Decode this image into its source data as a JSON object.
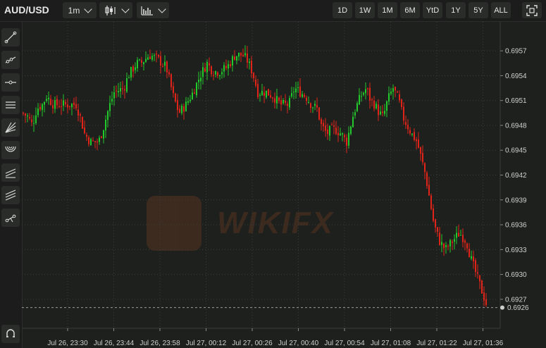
{
  "header": {
    "symbol": "AUD/USD",
    "interval": "1m",
    "ranges": [
      "1D",
      "1W",
      "1M",
      "6M",
      "YtD",
      "1Y",
      "5Y",
      "ALL"
    ]
  },
  "sidebar_tools": [
    "trend-line-icon",
    "ray-icon",
    "horizontal-line-icon",
    "parallel-channel-icon",
    "fib-fan-icon",
    "fib-arc-icon",
    "fib-retracement-icon",
    "fib-extension-icon",
    "pitchfork-icon",
    "magnet-icon"
  ],
  "watermark": "WIKIFX",
  "colors": {
    "up": "#22c92b",
    "down": "#e0241a",
    "background": "#1e201e"
  },
  "chart_data": {
    "type": "candlestick",
    "yticks": [
      0.6957,
      0.6954,
      0.6951,
      0.6948,
      0.6945,
      0.6942,
      0.6939,
      0.6936,
      0.6933,
      0.693,
      0.6927
    ],
    "ylim": [
      0.69235,
      0.69605
    ],
    "xtick_labels": [
      "Jul 26, 23:30",
      "Jul 26, 23:44",
      "Jul 26, 23:58",
      "Jul 27, 00:12",
      "Jul 27, 00:26",
      "Jul 27, 00:40",
      "Jul 27, 00:54",
      "Jul 27, 01:08",
      "Jul 27, 01:22",
      "Jul 27, 01:36"
    ],
    "last_price": 0.6926,
    "close_path": [
      [
        0,
        0.69495
      ],
      [
        8,
        0.6949
      ],
      [
        14,
        0.6948
      ],
      [
        20,
        0.695
      ],
      [
        28,
        0.69505
      ],
      [
        34,
        0.69515
      ],
      [
        44,
        0.69505
      ],
      [
        56,
        0.69505
      ],
      [
        68,
        0.69505
      ],
      [
        76,
        0.69505
      ],
      [
        82,
        0.6949
      ],
      [
        88,
        0.6947
      ],
      [
        96,
        0.6946
      ],
      [
        104,
        0.6946
      ],
      [
        108,
        0.6946
      ],
      [
        114,
        0.69475
      ],
      [
        122,
        0.695
      ],
      [
        130,
        0.6952
      ],
      [
        144,
        0.69525
      ],
      [
        150,
        0.6954
      ],
      [
        162,
        0.69555
      ],
      [
        168,
        0.69555
      ],
      [
        180,
        0.69565
      ],
      [
        192,
        0.6956
      ],
      [
        204,
        0.6955
      ],
      [
        214,
        0.69515
      ],
      [
        222,
        0.69495
      ],
      [
        232,
        0.69505
      ],
      [
        242,
        0.6952
      ],
      [
        252,
        0.6954
      ],
      [
        262,
        0.69555
      ],
      [
        270,
        0.69545
      ],
      [
        280,
        0.69545
      ],
      [
        290,
        0.6955
      ],
      [
        302,
        0.69565
      ],
      [
        312,
        0.69565
      ],
      [
        318,
        0.6956
      ],
      [
        326,
        0.69545
      ],
      [
        334,
        0.6952
      ],
      [
        346,
        0.6952
      ],
      [
        356,
        0.69515
      ],
      [
        366,
        0.69505
      ],
      [
        378,
        0.69505
      ],
      [
        386,
        0.69525
      ],
      [
        394,
        0.6952
      ],
      [
        402,
        0.69515
      ],
      [
        410,
        0.69505
      ],
      [
        418,
        0.695
      ],
      [
        424,
        0.6948
      ],
      [
        432,
        0.6947
      ],
      [
        438,
        0.69475
      ],
      [
        444,
        0.69475
      ],
      [
        452,
        0.6947
      ],
      [
        460,
        0.6946
      ],
      [
        470,
        0.69495
      ],
      [
        480,
        0.69515
      ],
      [
        488,
        0.69525
      ],
      [
        494,
        0.6951
      ],
      [
        500,
        0.69505
      ],
      [
        506,
        0.69495
      ],
      [
        512,
        0.6949
      ],
      [
        518,
        0.6951
      ],
      [
        526,
        0.69525
      ],
      [
        534,
        0.6951
      ],
      [
        540,
        0.6949
      ],
      [
        546,
        0.6948
      ],
      [
        552,
        0.6947
      ],
      [
        560,
        0.6946
      ],
      [
        566,
        0.6944
      ],
      [
        572,
        0.6942
      ],
      [
        578,
        0.6939
      ],
      [
        584,
        0.6936
      ],
      [
        592,
        0.6934
      ],
      [
        600,
        0.6933
      ],
      [
        610,
        0.6934
      ],
      [
        620,
        0.6935
      ],
      [
        630,
        0.6934
      ],
      [
        636,
        0.6932
      ],
      [
        644,
        0.693
      ],
      [
        652,
        0.6928
      ],
      [
        660,
        0.6926
      ]
    ],
    "grid": true,
    "last_price_line": "dashed"
  }
}
